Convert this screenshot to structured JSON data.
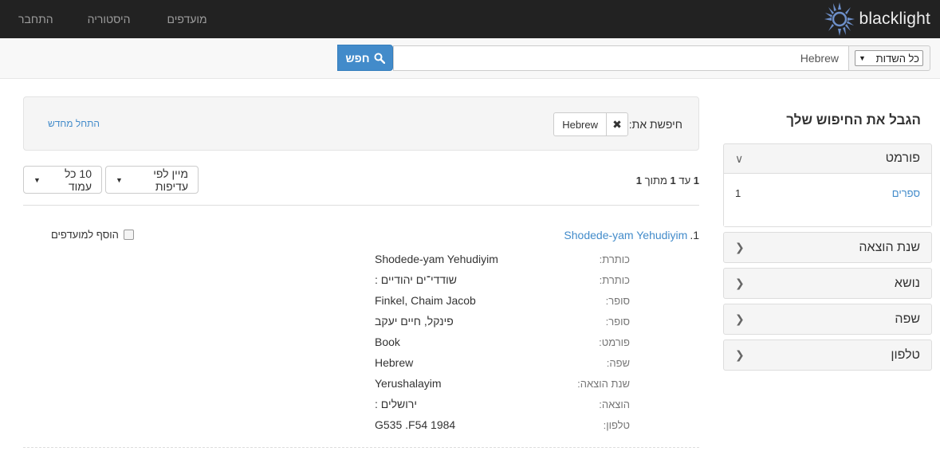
{
  "brand": {
    "name": "blacklight"
  },
  "nav": {
    "bookmarks": "מועדפים",
    "history": "היסטוריה",
    "login": "התחבר"
  },
  "search": {
    "field_select": "כל השדות",
    "query": "Hebrew",
    "button_label": "חפש"
  },
  "sidebar": {
    "heading": "הגבל את החיפוש שלך",
    "facets": [
      {
        "label": "פורמט",
        "open": true,
        "items": [
          {
            "label": "ספרים",
            "count": "1"
          }
        ]
      },
      {
        "label": "שנת הוצאה"
      },
      {
        "label": "נושא"
      },
      {
        "label": "שפה"
      },
      {
        "label": "טלפון"
      }
    ]
  },
  "constraints": {
    "label": "חיפשת את:",
    "value": "Hebrew",
    "start_over": "התחל מחדש"
  },
  "results": {
    "page_entries": {
      "from": "1",
      "to_word": "עד",
      "to": "1",
      "of_word": "מתוך",
      "total": "1"
    },
    "sort_label": "מיין לפי עדיפות",
    "per_page_label": "10 כל עמוד",
    "documents": [
      {
        "index": "1.",
        "title": "Shodede-yam Yehudiyim",
        "bookmark_label": "הוסף למועדפים",
        "fields": [
          {
            "label": "כותרת:",
            "value": "Shodede-yam Yehudiyim"
          },
          {
            "label": "כותרת:",
            "value": "שודדי־ים יהודיים :"
          },
          {
            "label": "סופר:",
            "value": "Finkel, Chaim Jacob"
          },
          {
            "label": "סופר:",
            "value": "פינקל, חיים יעקב"
          },
          {
            "label": "פורמט:",
            "value": "Book"
          },
          {
            "label": "שפה:",
            "value": "Hebrew"
          },
          {
            "label": "שנת הוצאה:",
            "value": "Yerushalayim"
          },
          {
            "label": "הוצאה:",
            "value": "ירושלים :"
          },
          {
            "label": "טלפון:",
            "value": "G535 .F54 1984"
          }
        ]
      }
    ]
  },
  "colors": {
    "navbar": "#222222",
    "link": "#428bca",
    "primary_button": "#428bca"
  },
  "icons": {
    "logo": "blacklight-sun-logo",
    "search": "search-icon",
    "remove": "remove-icon",
    "chevron": "chevron-icon"
  }
}
